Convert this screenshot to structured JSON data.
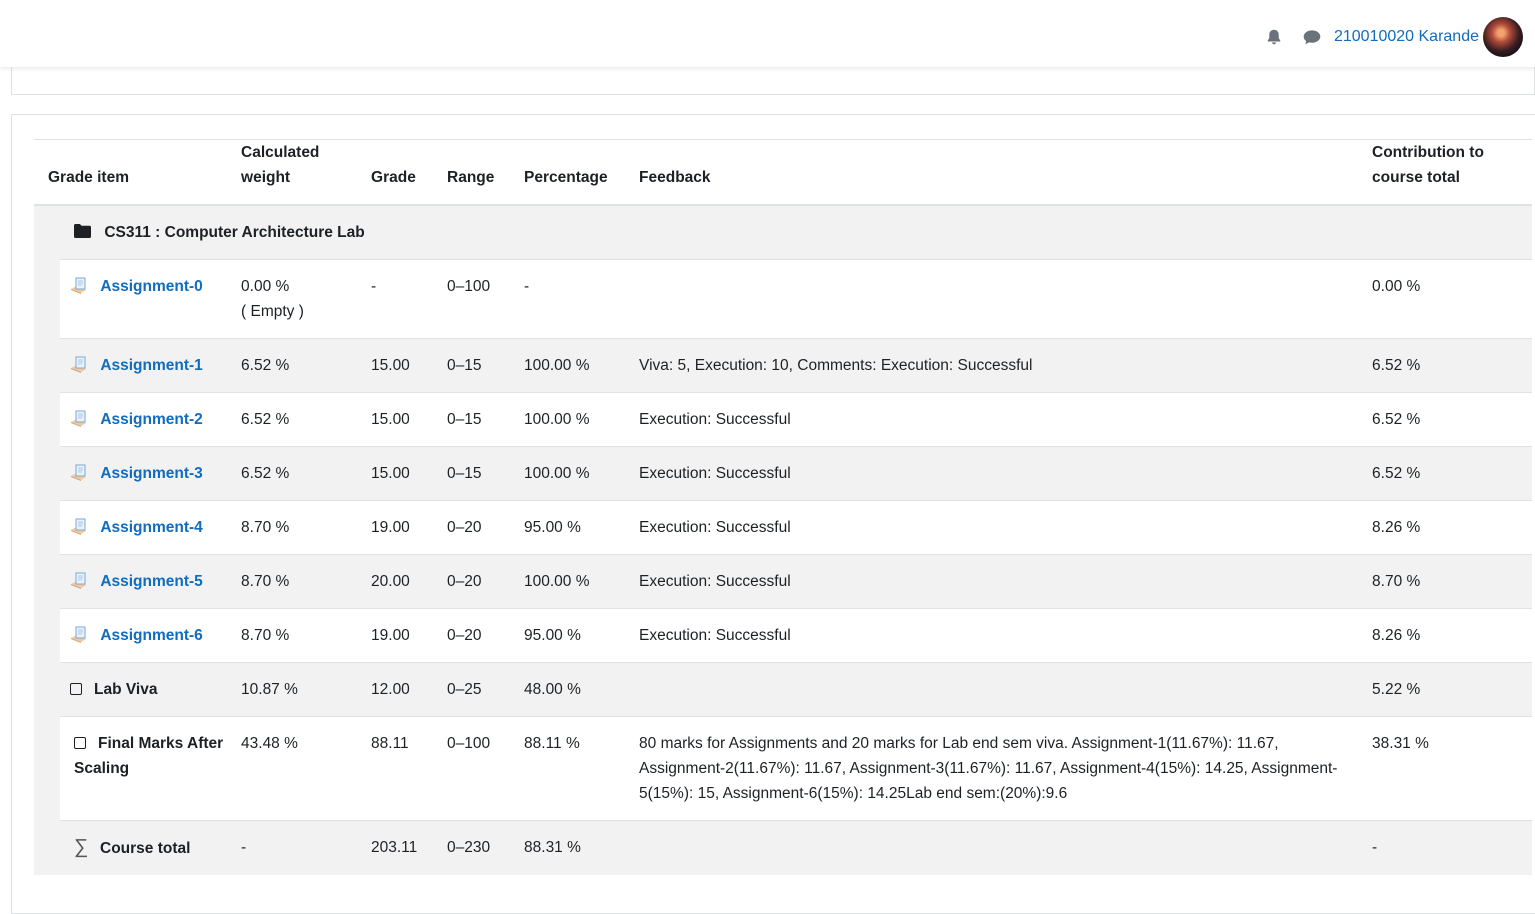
{
  "header": {
    "user_name": "210010020 Karande",
    "icons": [
      "bell-icon",
      "chat-icon"
    ]
  },
  "table": {
    "columns": [
      "Grade item",
      "Calculated weight",
      "Grade",
      "Range",
      "Percentage",
      "Feedback",
      "Contribution to course total"
    ],
    "category": "CS311 : Computer Architecture Lab",
    "rows": [
      {
        "name": "Assignment-0",
        "weight": "0.00 %",
        "weight_note": "( Empty )",
        "grade": "-",
        "range": "0–100",
        "percentage": "-",
        "feedback": "",
        "contribution": "0.00 %"
      },
      {
        "name": "Assignment-1",
        "weight": "6.52 %",
        "grade": "15.00",
        "range": "0–15",
        "percentage": "100.00 %",
        "feedback": "Viva: 5, Execution: 10, Comments: Execution: Successful",
        "contribution": "6.52 %"
      },
      {
        "name": "Assignment-2",
        "weight": "6.52 %",
        "grade": "15.00",
        "range": "0–15",
        "percentage": "100.00 %",
        "feedback": "Execution: Successful",
        "contribution": "6.52 %"
      },
      {
        "name": "Assignment-3",
        "weight": "6.52 %",
        "grade": "15.00",
        "range": "0–15",
        "percentage": "100.00 %",
        "feedback": "Execution: Successful",
        "contribution": "6.52 %"
      },
      {
        "name": "Assignment-4",
        "weight": "8.70 %",
        "grade": "19.00",
        "range": "0–20",
        "percentage": "95.00 %",
        "feedback": "Execution: Successful",
        "contribution": "8.26 %"
      },
      {
        "name": "Assignment-5",
        "weight": "8.70 %",
        "grade": "20.00",
        "range": "0–20",
        "percentage": "100.00 %",
        "feedback": "Execution: Successful",
        "contribution": "8.70 %"
      },
      {
        "name": "Assignment-6",
        "weight": "8.70 %",
        "grade": "19.00",
        "range": "0–20",
        "percentage": "95.00 %",
        "feedback": "Execution: Successful",
        "contribution": "8.26 %"
      },
      {
        "name": "Lab Viva",
        "weight": "10.87 %",
        "grade": "12.00",
        "range": "0–25",
        "percentage": "48.00 %",
        "feedback": "",
        "contribution": "5.22 %"
      },
      {
        "name": "Final Marks After Scaling",
        "weight": "43.48 %",
        "grade": "88.11",
        "range": "0–100",
        "percentage": "88.11 %",
        "feedback": "80 marks for Assignments and 20 marks for Lab end sem viva. Assignment-1(11.67%): 11.67, Assignment-2(11.67%): 11.67, Assignment-3(11.67%): 11.67, Assignment-4(15%): 14.25, Assignment-5(15%): 15, Assignment-6(15%): 14.25Lab end sem:(20%):9.6",
        "contribution": "38.31 %"
      }
    ],
    "total": {
      "name": "Course total",
      "weight": "-",
      "grade": "203.11",
      "range": "0–230",
      "percentage": "88.31 %",
      "contribution": "-"
    }
  }
}
